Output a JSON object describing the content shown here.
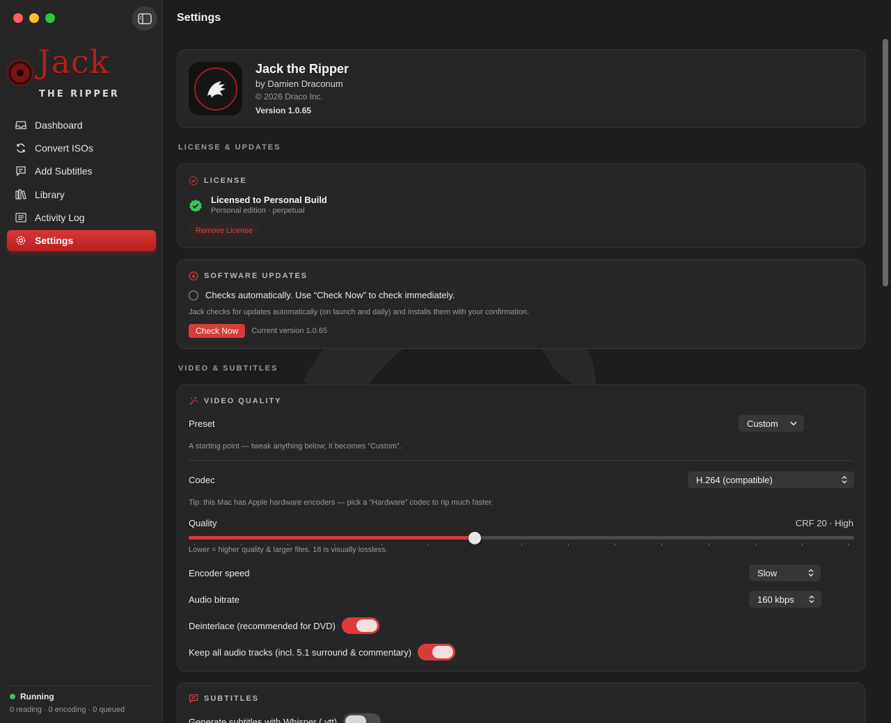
{
  "window": {
    "title": "Settings"
  },
  "brand": {
    "word": "Jack",
    "subtitle": "THE RIPPER"
  },
  "sidebar": {
    "items": [
      {
        "label": "Dashboard",
        "icon": "tray-icon"
      },
      {
        "label": "Convert ISOs",
        "icon": "arrows-rotate-icon"
      },
      {
        "label": "Add Subtitles",
        "icon": "captions-bubble-icon"
      },
      {
        "label": "Library",
        "icon": "books-icon"
      },
      {
        "label": "Activity Log",
        "icon": "list-icon"
      },
      {
        "label": "Settings",
        "icon": "gear-icon",
        "active": true
      }
    ],
    "status": {
      "label": "Running",
      "detail": "0 reading · 0 encoding · 0 queued",
      "color": "#34c759"
    }
  },
  "app_info": {
    "name": "Jack the Ripper",
    "author": "by Damien Draconum",
    "copyright": "© 2026 Draco Inc.",
    "version": "Version 1.0.65"
  },
  "sections": {
    "license_updates": "LICENSE & UPDATES",
    "video_subtitles": "VIDEO & SUBTITLES"
  },
  "license": {
    "header": "LICENSE",
    "title": "Licensed to Personal Build",
    "subtitle": "Personal edition · perpetual",
    "remove_button": "Remove License"
  },
  "updates": {
    "header": "SOFTWARE UPDATES",
    "radio_label": "Checks automatically. Use “Check Now” to check immediately.",
    "description": "Jack checks for updates automatically (on launch and daily) and installs them with your confirmation.",
    "check_button": "Check Now",
    "current_version": "Current version 1.0.65"
  },
  "video_quality": {
    "header": "VIDEO QUALITY",
    "preset_label": "Preset",
    "preset_value": "Custom",
    "preset_hint": "A starting point — tweak anything below; it becomes “Custom”.",
    "codec_label": "Codec",
    "codec_value": "H.264 (compatible)",
    "codec_hint": "Tip: this Mac has Apple hardware encoders — pick a “Hardware” codec to rip much faster.",
    "quality_label": "Quality",
    "quality_value": "CRF 20 · High",
    "quality_fraction": 0.43,
    "quality_hint": "Lower = higher quality & larger files. 18 is visually lossless.",
    "encoder_speed_label": "Encoder speed",
    "encoder_speed_value": "Slow",
    "audio_bitrate_label": "Audio bitrate",
    "audio_bitrate_value": "160 kbps",
    "deinterlace_label": "Deinterlace (recommended for DVD)",
    "deinterlace_on": true,
    "keep_audio_label": "Keep all audio tracks (incl. 5.1 surround & commentary)",
    "keep_audio_on": true
  },
  "subtitles": {
    "header": "SUBTITLES",
    "whisper_label": "Generate subtitles with Whisper (.vtt)",
    "whisper_on": false
  },
  "colors": {
    "accent": "#d93a3a",
    "background": "#1d1d1d",
    "card": "#262626"
  }
}
